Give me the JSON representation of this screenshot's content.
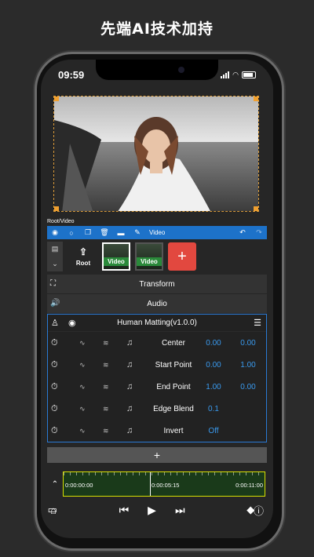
{
  "promo": {
    "title": "先端AI技术加持"
  },
  "status": {
    "time": "09:59"
  },
  "path": "Root/Video",
  "toolbar": {
    "label": "Video"
  },
  "clips": {
    "root_label": "Root",
    "video1": "Video",
    "video2": "Video"
  },
  "sections": {
    "transform": "Transform",
    "audio": "Audio"
  },
  "matting": {
    "title": "Human Matting(v1.0.0)",
    "rows": [
      {
        "label": "Center",
        "v1": "0.00",
        "v2": "0.00"
      },
      {
        "label": "Start Point",
        "v1": "0.00",
        "v2": "1.00"
      },
      {
        "label": "End Point",
        "v1": "1.00",
        "v2": "0.00"
      },
      {
        "label": "Edge Blend",
        "v1": "0.1",
        "v2": ""
      },
      {
        "label": "Invert",
        "v1": "Off",
        "v2": ""
      }
    ]
  },
  "timeline": {
    "t0": "0:00:00:00",
    "t1": "0:00:05:15",
    "t2": "0:00:11:00"
  },
  "colors": {
    "accent": "#1d72c9",
    "add": "#e2483f",
    "handle": "#f0a030",
    "value": "#3a9aee"
  }
}
